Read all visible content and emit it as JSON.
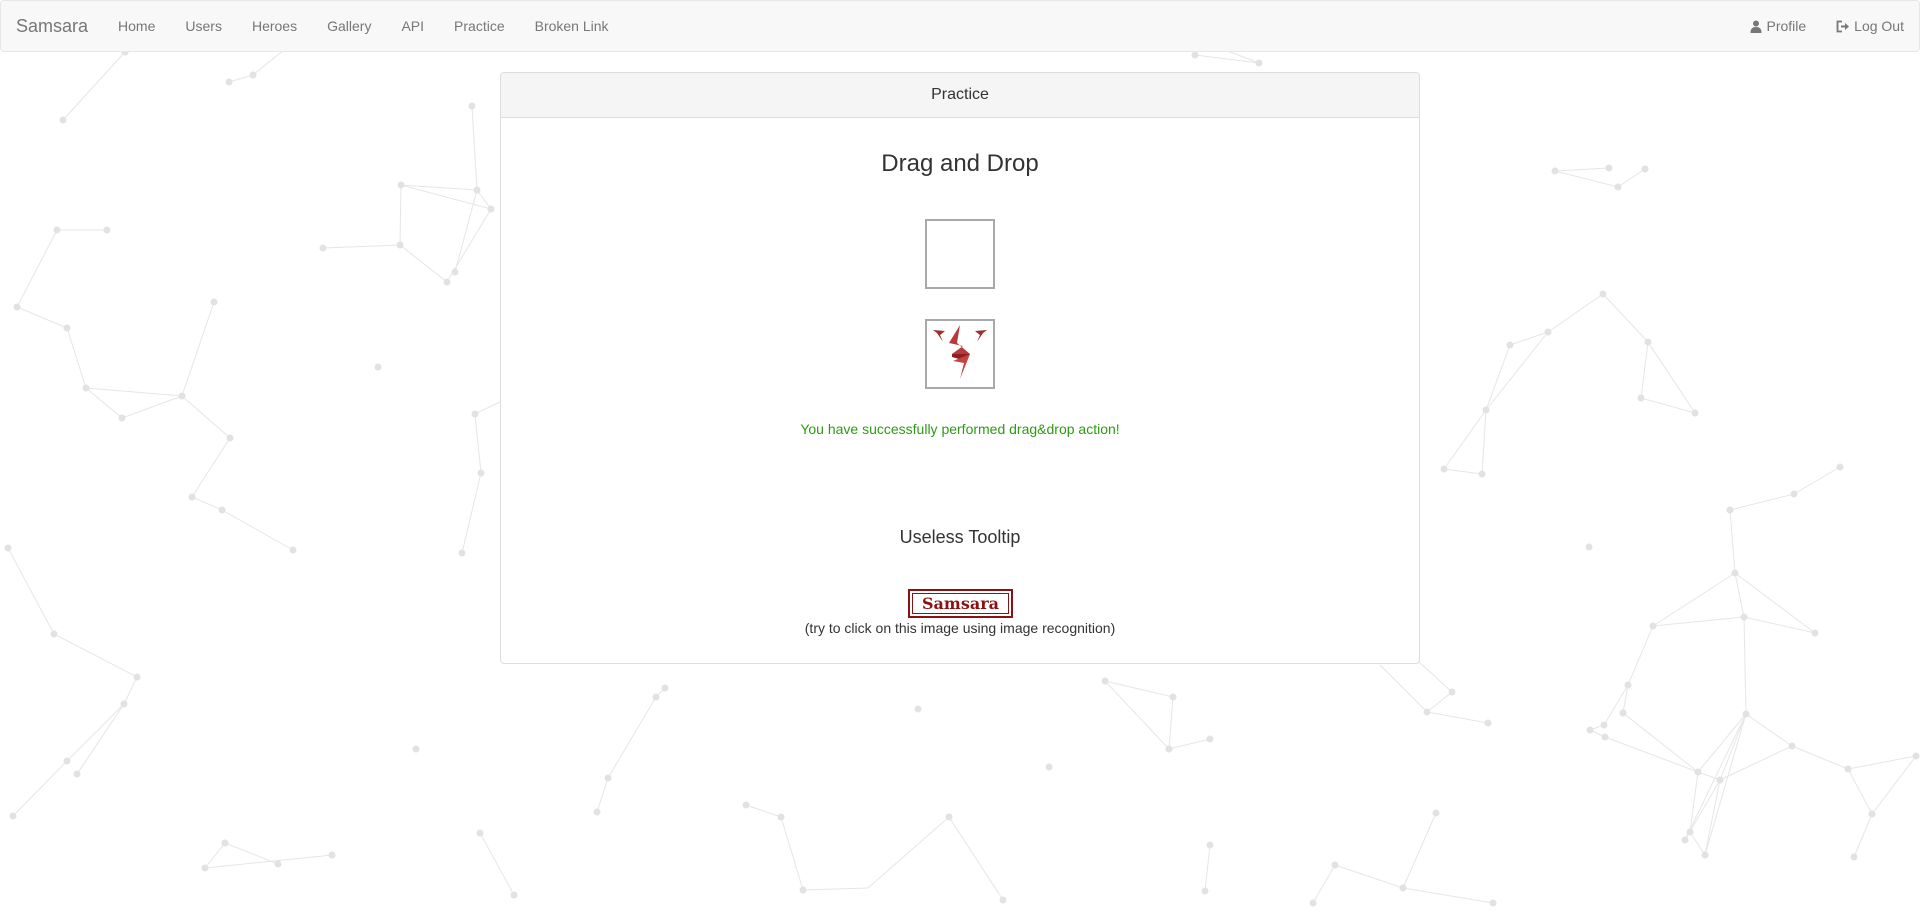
{
  "navbar": {
    "brand": "Samsara",
    "links": [
      "Home",
      "Users",
      "Heroes",
      "Gallery",
      "API",
      "Practice",
      "Broken Link"
    ],
    "profile_label": "Profile",
    "logout_label": "Log Out",
    "profile_icon": "user-icon",
    "logout_icon": "logout-icon"
  },
  "panel": {
    "title": "Practice",
    "drag_drop_heading": "Drag and Drop",
    "success_message": "You have successfully performed drag&drop action!",
    "tooltip_heading": "Useless Tooltip",
    "logo_text": "Samsara",
    "image_caption": "(try to click on this image using image recognition)"
  },
  "colors": {
    "success": "#2e9a13",
    "brand_red": "#8b1212",
    "navbar_bg": "#f8f8f8"
  }
}
